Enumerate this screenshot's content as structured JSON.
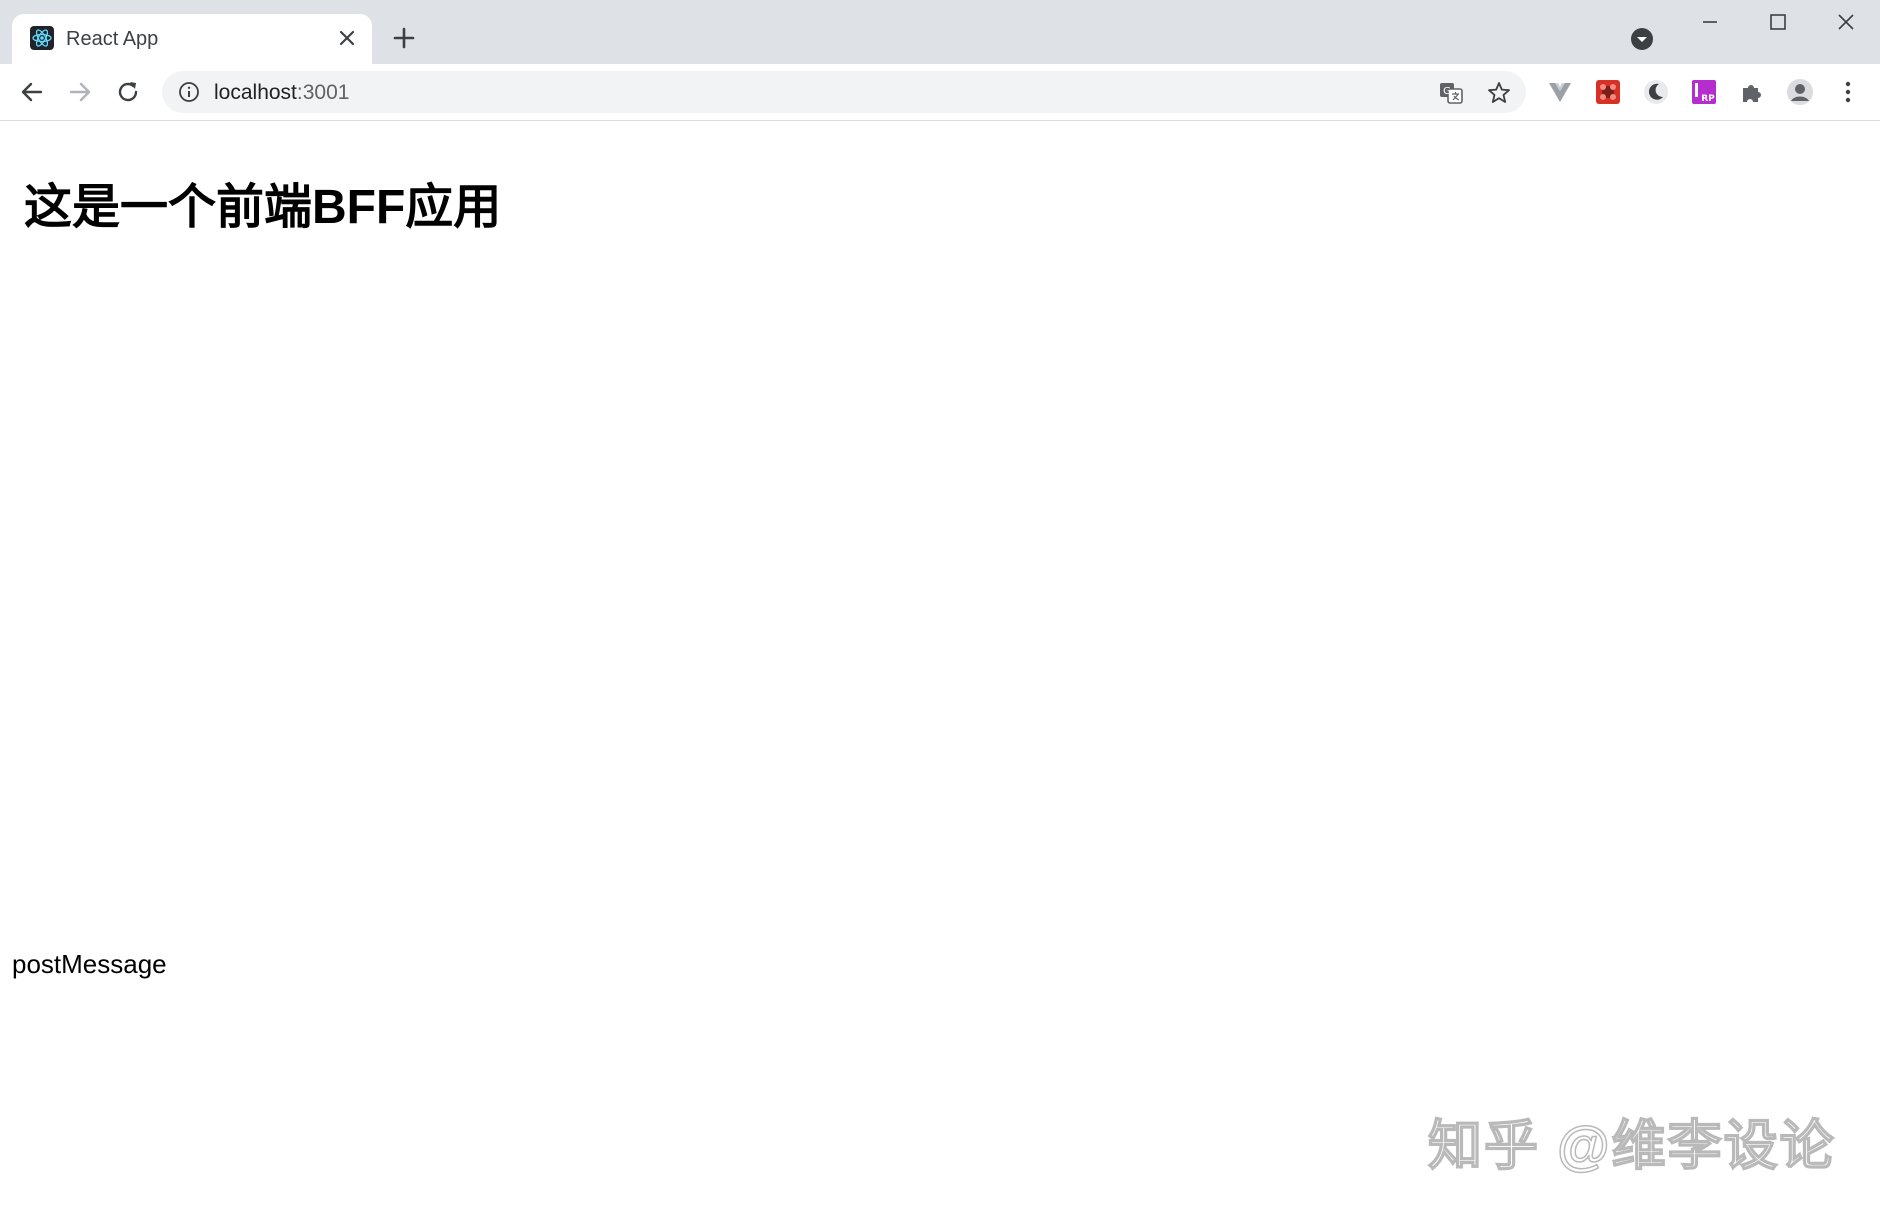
{
  "browser": {
    "tab": {
      "title": "React App",
      "favicon": "react-logo-icon"
    },
    "address_bar": {
      "host": "localhost",
      "port": ":3001"
    },
    "extensions": [
      "vue-devtools-icon",
      "extension-red-icon",
      "dark-mode-icon",
      "axure-rp-icon",
      "puzzle-icon"
    ],
    "accent_colors": {
      "tabstrip": "#dee1e6",
      "omnibox": "#f1f3f4",
      "react": "#61dafb"
    }
  },
  "page": {
    "heading": "这是一个前端BFF应用",
    "message": "postMessage",
    "watermark": "知乎 @维李设论"
  }
}
